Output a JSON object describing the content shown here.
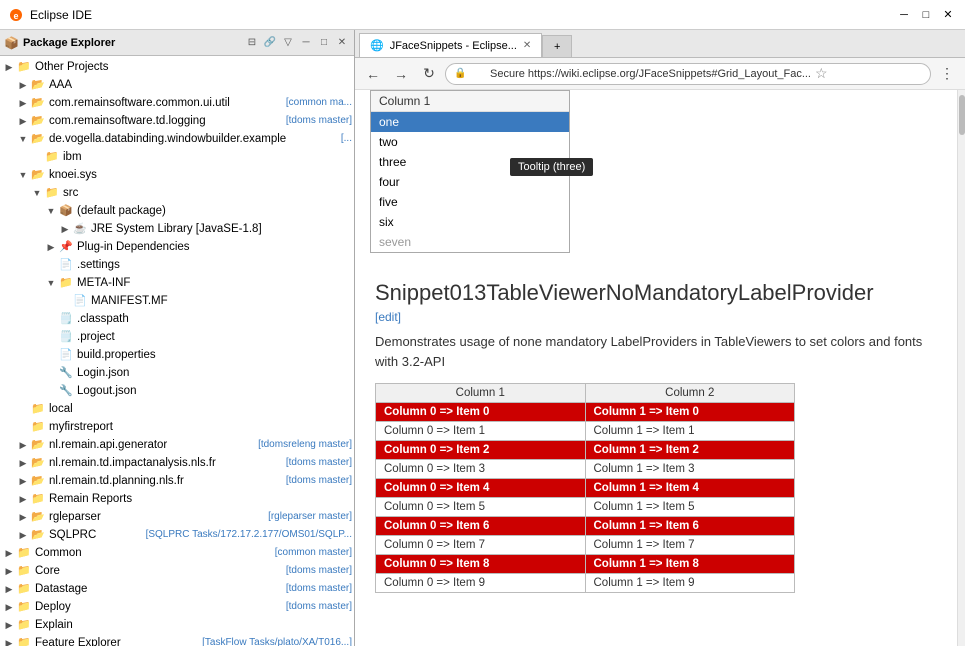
{
  "titlebar": {
    "icon": "eclipse",
    "title": "Eclipse IDE"
  },
  "leftPanel": {
    "title": "Package Explorer",
    "treeItems": [
      {
        "level": 0,
        "arrow": "▶",
        "icon": "folder",
        "label": "Other Projects",
        "tag": ""
      },
      {
        "level": 1,
        "arrow": "▶",
        "icon": "project",
        "label": "AAA",
        "tag": ""
      },
      {
        "level": 1,
        "arrow": "▶",
        "icon": "project",
        "label": "com.remainsoftware.common.ui.util",
        "tag": "[common ma..."
      },
      {
        "level": 1,
        "arrow": "▶",
        "icon": "project",
        "label": "com.remainsoftware.td.logging",
        "tag": "[tdoms master]"
      },
      {
        "level": 1,
        "arrow": "▼",
        "icon": "project",
        "label": "de.vogella.databinding.windowbuilder.example",
        "tag": "[..."
      },
      {
        "level": 2,
        "arrow": "",
        "icon": "folder",
        "label": "ibm",
        "tag": ""
      },
      {
        "level": 1,
        "arrow": "▼",
        "icon": "project",
        "label": "knoei.sys",
        "tag": ""
      },
      {
        "level": 2,
        "arrow": "▼",
        "icon": "folder",
        "label": "src",
        "tag": ""
      },
      {
        "level": 3,
        "arrow": "▼",
        "icon": "package",
        "label": "(default package)",
        "tag": ""
      },
      {
        "level": 4,
        "arrow": "▶",
        "icon": "jar",
        "label": "JRE System Library [JavaSE-1.8]",
        "tag": ""
      },
      {
        "level": 3,
        "arrow": "▶",
        "icon": "ref",
        "label": "Plug-in Dependencies",
        "tag": ""
      },
      {
        "level": 3,
        "arrow": "",
        "icon": "file",
        "label": ".settings",
        "tag": ""
      },
      {
        "level": 3,
        "arrow": "▼",
        "icon": "folder",
        "label": "META-INF",
        "tag": ""
      },
      {
        "level": 4,
        "arrow": "",
        "icon": "file",
        "label": "MANIFEST.MF",
        "tag": ""
      },
      {
        "level": 3,
        "arrow": "",
        "icon": "file-x",
        "label": ".classpath",
        "tag": ""
      },
      {
        "level": 3,
        "arrow": "",
        "icon": "file-x",
        "label": ".project",
        "tag": ""
      },
      {
        "level": 3,
        "arrow": "",
        "icon": "file",
        "label": "build.properties",
        "tag": ""
      },
      {
        "level": 3,
        "arrow": "",
        "icon": "file-j",
        "label": "Login.json",
        "tag": ""
      },
      {
        "level": 3,
        "arrow": "",
        "icon": "file-j",
        "label": "Logout.json",
        "tag": ""
      },
      {
        "level": 1,
        "arrow": "",
        "icon": "folder",
        "label": "local",
        "tag": ""
      },
      {
        "level": 1,
        "arrow": "",
        "icon": "folder",
        "label": "myfirstreport",
        "tag": ""
      },
      {
        "level": 1,
        "arrow": "▶",
        "icon": "project",
        "label": "nl.remain.api.generator",
        "tag": "[tdomsreleng master]"
      },
      {
        "level": 1,
        "arrow": "▶",
        "icon": "project",
        "label": "nl.remain.td.impactanalysis.nls.fr",
        "tag": "[tdoms master]"
      },
      {
        "level": 1,
        "arrow": "▶",
        "icon": "project",
        "label": "nl.remain.td.planning.nls.fr",
        "tag": "[tdoms master]"
      },
      {
        "level": 1,
        "arrow": "▶",
        "icon": "folder",
        "label": "Remain Reports",
        "tag": ""
      },
      {
        "level": 1,
        "arrow": "▶",
        "icon": "project",
        "label": "rgleparser",
        "tag": "[rgleparser master]"
      },
      {
        "level": 1,
        "arrow": "▶",
        "icon": "project",
        "label": "SQLPRC",
        "tag": "[SQLPRC Tasks/172.17.2.177/OMS01/SQLP..."
      },
      {
        "level": 0,
        "arrow": "▶",
        "icon": "folder",
        "label": "Common",
        "tag": "[common master]"
      },
      {
        "level": 0,
        "arrow": "▶",
        "icon": "folder",
        "label": "Core",
        "tag": "[tdoms master]"
      },
      {
        "level": 0,
        "arrow": "▶",
        "icon": "folder",
        "label": "Datastage",
        "tag": "[tdoms master]"
      },
      {
        "level": 0,
        "arrow": "▶",
        "icon": "folder",
        "label": "Deploy",
        "tag": "[tdoms master]"
      },
      {
        "level": 0,
        "arrow": "▶",
        "icon": "folder",
        "label": "Explain",
        "tag": ""
      },
      {
        "level": 0,
        "arrow": "▶",
        "icon": "folder",
        "label": "Feature Explorer",
        "tag": "[TaskFlow Tasks/plato/XA/T016...]"
      }
    ]
  },
  "browser": {
    "tab": {
      "title": "JFaceSnippets - Eclipse...",
      "icon": "globe"
    },
    "url": "https://wiki.eclipse.org/JFaceSnippets#Grid_Layout_Fac...",
    "urlDisplay": "Secure  https://wiki.eclipse.org/JFaceSnippets#Grid_Layout_Fac...",
    "dropdown": {
      "header": "Column 1",
      "items": [
        {
          "label": "one",
          "selected": true
        },
        {
          "label": "two",
          "selected": false
        },
        {
          "label": "three",
          "selected": false
        },
        {
          "label": "four",
          "selected": false
        },
        {
          "label": "five",
          "selected": false
        },
        {
          "label": "six",
          "selected": false
        },
        {
          "label": "seven",
          "selected": false
        }
      ]
    },
    "tooltip": "Tooltip (three)",
    "snippetTitle": "Snippet013TableViewerNoMandatoryLabelProvider",
    "editLink": "[edit]",
    "description": "Demonstrates usage of none mandatory LabelProviders in TableViewers to set colors and fonts with 3.2-API",
    "table": {
      "headers": [
        "Column 1",
        "Column 2"
      ],
      "rows": [
        {
          "c1": "Column 0 => Item 0",
          "c2": "Column 1 => Item 0",
          "highlight": true
        },
        {
          "c1": "Column 0 => Item 1",
          "c2": "Column 1 => Item 1",
          "highlight": false
        },
        {
          "c1": "Column 0 => Item 2",
          "c2": "Column 1 => Item 2",
          "highlight": true
        },
        {
          "c1": "Column 0 => Item 3",
          "c2": "Column 1 => Item 3",
          "highlight": false
        },
        {
          "c1": "Column 0 => Item 4",
          "c2": "Column 1 => Item 4",
          "highlight": true
        },
        {
          "c1": "Column 0 => Item 5",
          "c2": "Column 1 => Item 5",
          "highlight": false
        },
        {
          "c1": "Column 0 => Item 6",
          "c2": "Column 1 => Item 6",
          "highlight": true
        },
        {
          "c1": "Column 0 => Item 7",
          "c2": "Column 1 => Item 7",
          "highlight": false
        },
        {
          "c1": "Column 0 => Item 8",
          "c2": "Column 1 => Item 8",
          "highlight": true
        },
        {
          "c1": "Column 0 => Item 9",
          "c2": "Column 1 => Item 9",
          "highlight": false
        }
      ]
    }
  }
}
